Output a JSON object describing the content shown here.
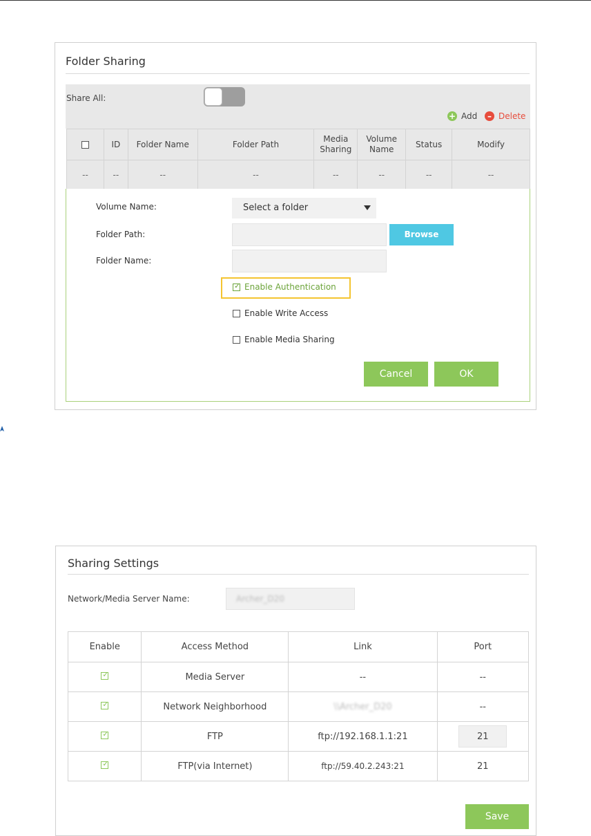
{
  "folder_sharing": {
    "title": "Folder Sharing",
    "share_all_label": "Share All:",
    "add_label": "Add",
    "delete_label": "Delete",
    "columns": [
      "ID",
      "Folder Name",
      "Folder Path",
      "Media\nSharing",
      "Volume\nName",
      "Status",
      "Modify"
    ],
    "empty_row": [
      "--",
      "--",
      "--",
      "--",
      "--",
      "--",
      "--",
      "--"
    ],
    "form": {
      "volume_name_label": "Volume Name:",
      "volume_select_value": "Select a folder",
      "folder_path_label": "Folder Path:",
      "browse_label": "Browse",
      "folder_name_label": "Folder Name:",
      "enable_authentication": "Enable Authentication",
      "enable_write_access": "Enable Write Access",
      "enable_media_sharing": "Enable Media Sharing",
      "cancel_label": "Cancel",
      "ok_label": "OK"
    }
  },
  "sharing_settings": {
    "title": "Sharing Settings",
    "server_name_label": "Network/Media Server Name:",
    "server_name_value": "Archer_D20",
    "columns": [
      "Enable",
      "Access Method",
      "Link",
      "Port"
    ],
    "rows": [
      {
        "method": "Media Server",
        "link": "--",
        "port": "--"
      },
      {
        "method": "Network Neighborhood",
        "link": "\\\\Archer_D20",
        "port": "--"
      },
      {
        "method": "FTP",
        "link": "ftp://192.168.1.1:21",
        "port": "21"
      },
      {
        "method": "FTP(via Internet)",
        "link": "ftp://59.40.2.243:21",
        "port": "21"
      }
    ],
    "save_label": "Save"
  },
  "colors": {
    "accent_green": "#8dc75a",
    "browse_blue": "#4fc8e3",
    "highlight_yellow": "#f4c430",
    "delete_red": "#e74c3c"
  }
}
